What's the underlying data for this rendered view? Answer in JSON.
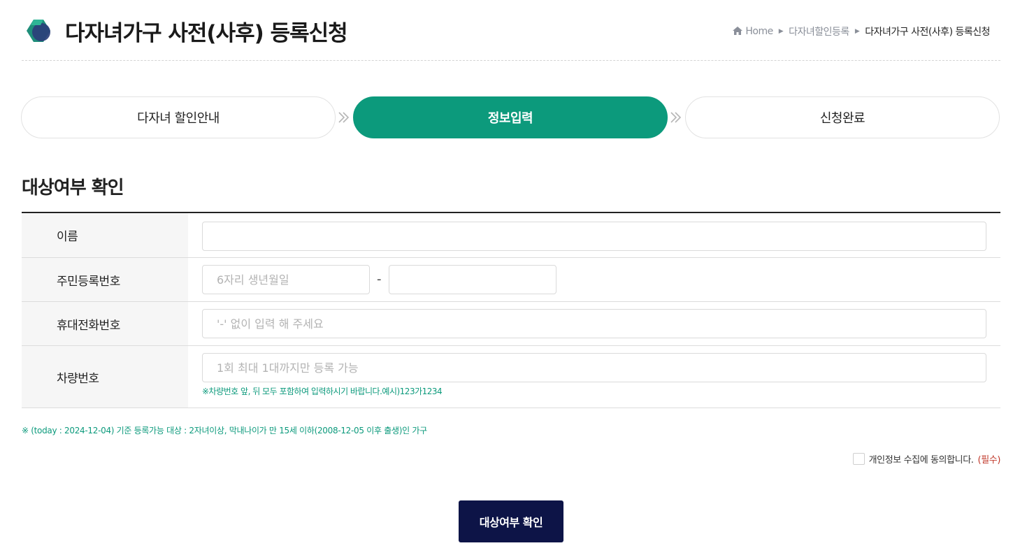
{
  "header": {
    "title": "다자녀가구 사전(사후) 등록신청",
    "breadcrumb": {
      "home": "Home",
      "level1": "다자녀할인등록",
      "current": "다자녀가구 사전(사후) 등록신청"
    }
  },
  "steps": [
    {
      "label": "다자녀 할인안내",
      "active": false
    },
    {
      "label": "정보입력",
      "active": true
    },
    {
      "label": "신청완료",
      "active": false
    }
  ],
  "section": {
    "title": "대상여부 확인"
  },
  "form": {
    "name": {
      "label": "이름",
      "value": "",
      "placeholder": ""
    },
    "rrn": {
      "label": "주민등록번호",
      "front_placeholder": "6자리 생년월일",
      "back_placeholder": "",
      "dash": "-"
    },
    "phone": {
      "label": "휴대전화번호",
      "placeholder": "'-' 없이 입력 해 주세요"
    },
    "car": {
      "label": "차량번호",
      "placeholder": "1회 최대 1대까지만 등록 가능",
      "note": "※차량번호 앞, 뒤 모두 포함하여 입력하시기 바랍니다.예시)123가1234"
    }
  },
  "info_note": "※ (today : 2024-12-04) 기준 등록가능 대상 : 2자녀이상, 막내나이가 만 15세 이하(2008-12-05 이후 출생)인 가구",
  "agree": {
    "text": "개인정보 수집에 동의합니다.",
    "required": "(필수)",
    "checked": false
  },
  "submit_label": "대상여부 확인",
  "colors": {
    "accent": "#0c9a7c",
    "button": "#0d1447",
    "required": "#c0392b"
  }
}
